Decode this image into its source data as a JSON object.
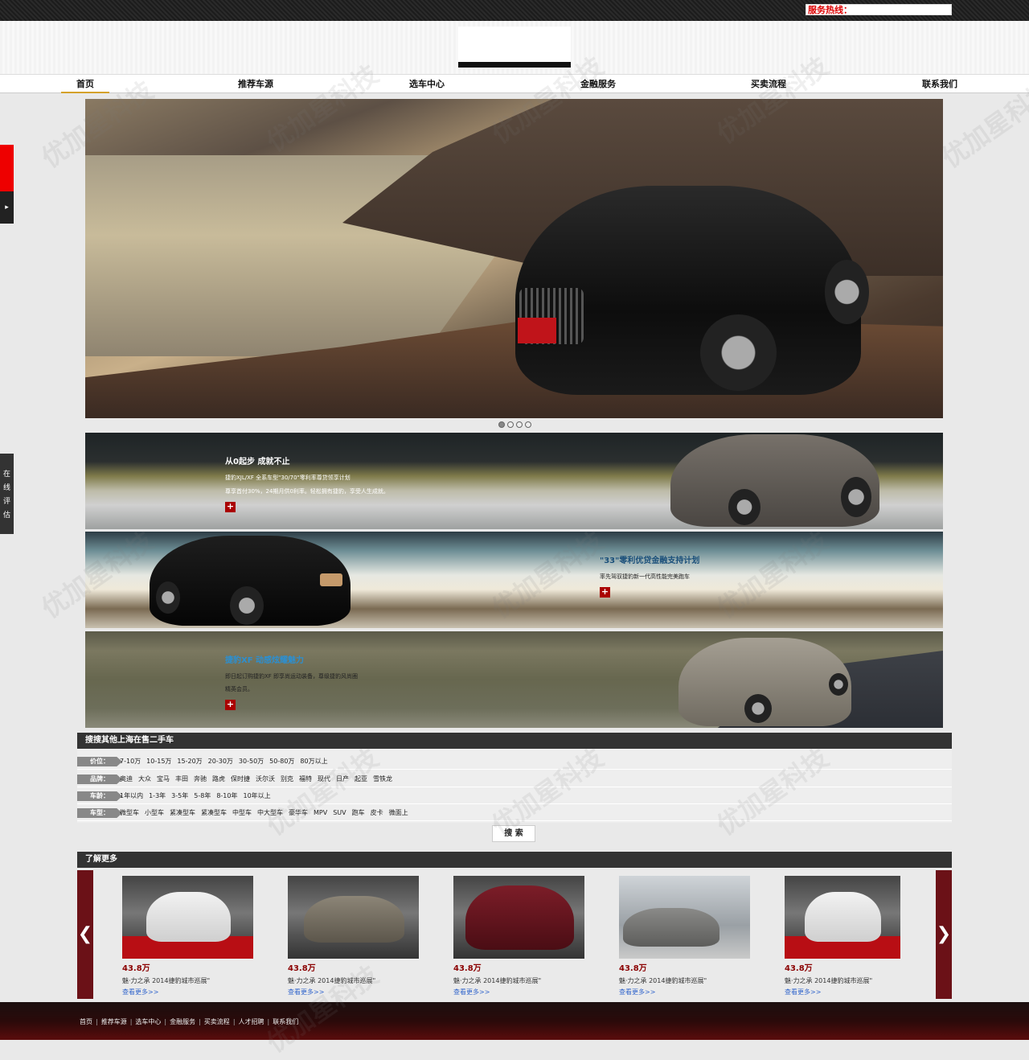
{
  "top": {
    "hotline": "服务热线："
  },
  "nav": {
    "items": [
      "首页",
      "推荐车源",
      "选车中心",
      "金融服务",
      "买卖流程",
      "联系我们"
    ]
  },
  "side": {
    "eval_chars": [
      "在",
      "线",
      "评",
      "估"
    ],
    "arrow": "▸"
  },
  "hero": {
    "dots": 4,
    "active_dot": 1
  },
  "banners": [
    {
      "title": "从0起步 成就不止",
      "lines": [
        "捷豹XJL/XF 全系车型\"30/70\"零利率尊贷领享计划",
        "尊享首付30%，24期月供0利率。轻松拥有捷豹，享受人生成就。"
      ]
    },
    {
      "title": "\"33\"零利优贷金融支持计划",
      "lines": [
        "率先驾驭捷豹新一代高性能完美跑车"
      ]
    },
    {
      "title": "捷豹XF 动感炫耀魅力",
      "lines": [
        "即日起订购捷豹XF 即享尚运动装备，尊级捷豹风尚圈",
        "精英会员。"
      ]
    }
  ],
  "search": {
    "heading": "搜搜其他上海在售二手车",
    "rows": [
      {
        "label": "价位：",
        "opts": [
          "7-10万",
          "10-15万",
          "15-20万",
          "20-30万",
          "30-50万",
          "50-80万",
          "80万以上"
        ]
      },
      {
        "label": "品牌：",
        "opts": [
          "奥迪",
          "大众",
          "宝马",
          "丰田",
          "奔驰",
          "路虎",
          "保时捷",
          "沃尔沃",
          "别克",
          "福特",
          "现代",
          "日产",
          "起亚",
          "雪铁龙"
        ]
      },
      {
        "label": "车龄：",
        "opts": [
          "1年以内",
          "1-3年",
          "3-5年",
          "5-8年",
          "8-10年",
          "10年以上"
        ]
      },
      {
        "label": "车型：",
        "opts": [
          "微型车",
          "小型车",
          "紧凑型车",
          "紧凑型车",
          "中型车",
          "中大型车",
          "豪华车",
          "MPV",
          "SUV",
          "跑车",
          "皮卡",
          "微面上"
        ]
      }
    ],
    "button": "搜 索"
  },
  "more": {
    "heading": "了解更多",
    "prev": "❮",
    "next": "❯",
    "cards": [
      {
        "price": "43.8万",
        "desc": "魅·力之承 2014捷豹城市巡展\"",
        "link": "查看更多>>"
      },
      {
        "price": "43.8万",
        "desc": "魅·力之承 2014捷豹城市巡展\"",
        "link": "查看更多>>"
      },
      {
        "price": "43.8万",
        "desc": "魅·力之承 2014捷豹城市巡展\"",
        "link": "查看更多>>"
      },
      {
        "price": "43.8万",
        "desc": "魅·力之承 2014捷豹城市巡展\"",
        "link": "查看更多>>"
      },
      {
        "price": "43.8万",
        "desc": "魅·力之承 2014捷豹城市巡展\"",
        "link": "查看更多>>"
      }
    ]
  },
  "footer": {
    "links": [
      "首页",
      "推荐车源",
      "选车中心",
      "金融服务",
      "买卖流程",
      "人才招聘",
      "联系我们"
    ]
  },
  "watermark": "优加星科技",
  "colors": {
    "accent": "#d4a12a",
    "brand_red": "#8b0000",
    "nav_active": "#d4a12a"
  }
}
